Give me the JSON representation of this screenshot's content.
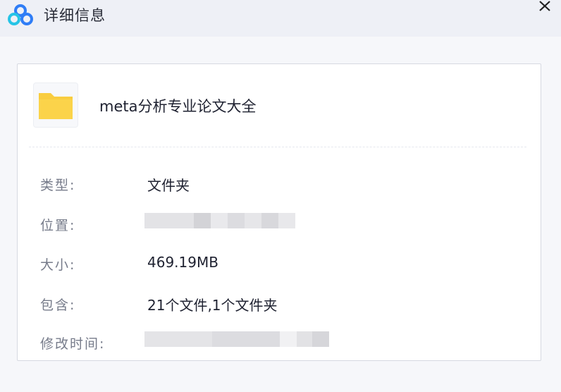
{
  "window": {
    "title": "详细信息",
    "app_logo_icon": "cloud-logo-icon",
    "close_icon": "close-icon",
    "close_label": "✕"
  },
  "folder": {
    "icon": "folder-icon",
    "name": "meta分析专业论文大全",
    "folder_color": "#f9cd3f"
  },
  "details": {
    "type_label": "类型:",
    "type_value": "文件夹",
    "location_label": "位置:",
    "location_value_redacted": true,
    "size_label": "大小:",
    "size_value": "469.19MB",
    "contains_label": "包含:",
    "contains_value": "21个文件,1个文件夹",
    "modified_label": "修改时间:",
    "modified_value_redacted": true
  },
  "colors": {
    "titlebar_bg": "#eef0f6",
    "card_bg": "#ffffff",
    "label_text": "#767b8a",
    "value_text": "#1e2130",
    "logo_blue": "#2f7df6",
    "logo_cyan": "#27c4e6"
  }
}
